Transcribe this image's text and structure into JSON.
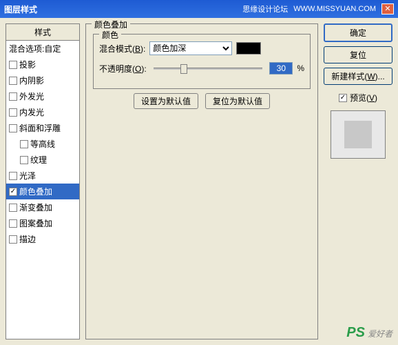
{
  "titlebar": {
    "title": "图层样式",
    "right_text": "思缘设计论坛",
    "right_url": "WWW.MISSYUAN.COM"
  },
  "styles": {
    "header": "样式",
    "blend_options": "混合选项:自定",
    "items": [
      {
        "key": "drop_shadow",
        "label": "投影",
        "checked": false
      },
      {
        "key": "inner_shadow",
        "label": "内阴影",
        "checked": false
      },
      {
        "key": "outer_glow",
        "label": "外发光",
        "checked": false
      },
      {
        "key": "inner_glow",
        "label": "内发光",
        "checked": false
      },
      {
        "key": "bevel",
        "label": "斜面和浮雕",
        "checked": false
      },
      {
        "key": "contour",
        "label": "等高线",
        "checked": false,
        "indent": true
      },
      {
        "key": "texture",
        "label": "纹理",
        "checked": false,
        "indent": true
      },
      {
        "key": "satin",
        "label": "光泽",
        "checked": false
      },
      {
        "key": "color_overlay",
        "label": "颜色叠加",
        "checked": true,
        "selected": true
      },
      {
        "key": "gradient_overlay",
        "label": "渐变叠加",
        "checked": false
      },
      {
        "key": "pattern_overlay",
        "label": "图案叠加",
        "checked": false
      },
      {
        "key": "stroke",
        "label": "描边",
        "checked": false
      }
    ]
  },
  "panel": {
    "group_title": "颜色叠加",
    "inner_title": "颜色",
    "blend_label_pre": "混合模式(",
    "blend_key": "B",
    "blend_label_post": "):",
    "blend_value": "颜色加深",
    "opacity_label_pre": "不透明度(",
    "opacity_key": "O",
    "opacity_label_post": "):",
    "opacity_value": "30",
    "percent": "%",
    "set_default": "设置为默认值",
    "reset_default": "复位为默认值",
    "swatch_color": "#000000"
  },
  "right": {
    "ok": "确定",
    "reset": "复位",
    "new_style_pre": "新建样式(",
    "new_style_key": "W",
    "new_style_post": ")...",
    "preview_pre": "预览(",
    "preview_key": "V",
    "preview_post": ")",
    "preview_checked": true
  },
  "watermark": {
    "main": "PS",
    "sub": "爱好者"
  }
}
